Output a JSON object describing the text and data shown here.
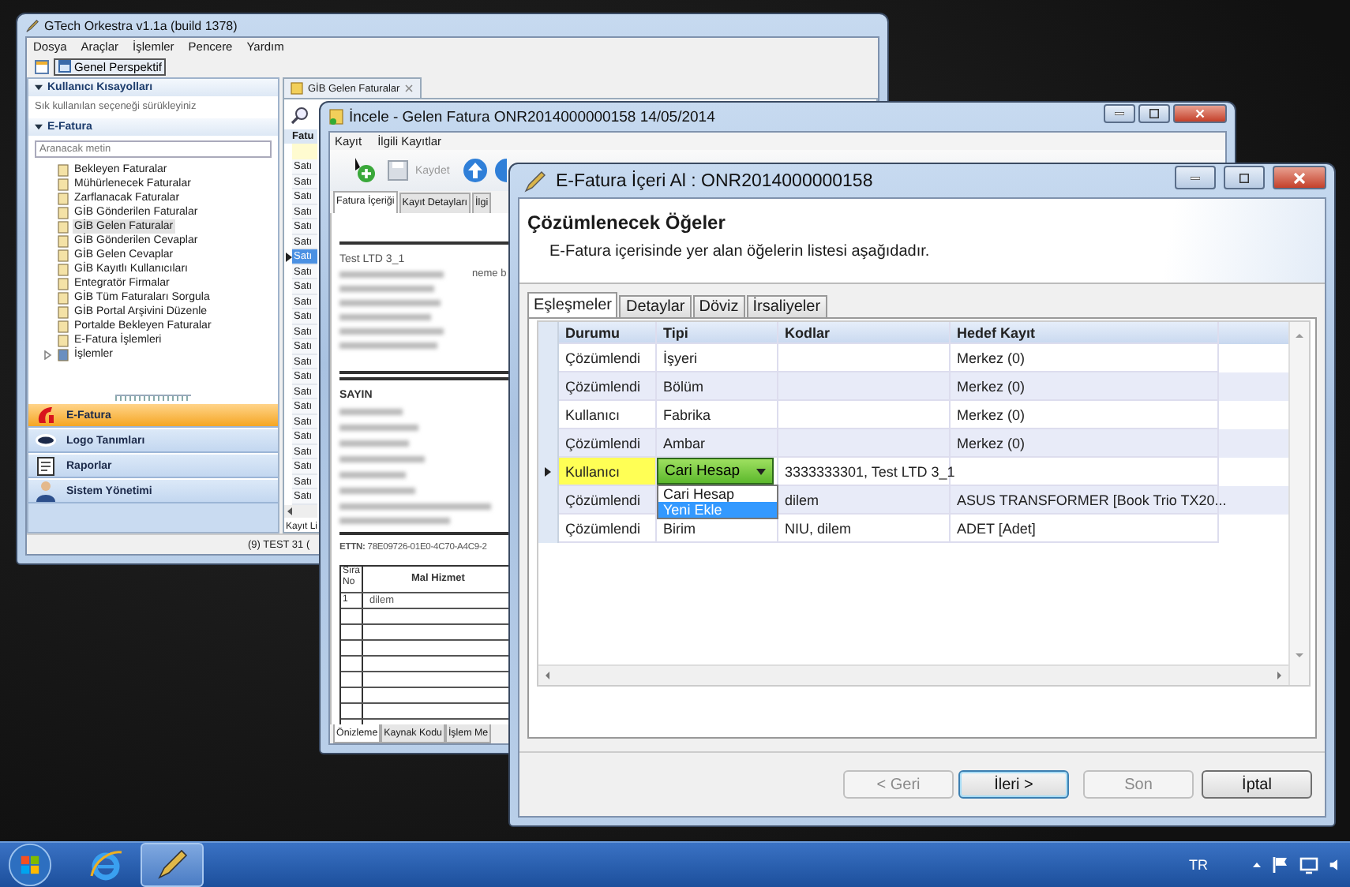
{
  "main_window": {
    "title": "GTech Orkestra v1.1a (build 1378)",
    "menu": [
      "Dosya",
      "Araçlar",
      "İşlemler",
      "Pencere",
      "Yardım"
    ],
    "perspective": "Genel Perspektif",
    "sidebar": {
      "shortcuts_header": "Kullanıcı Kısayolları",
      "shortcuts_hint": "Sık kullanılan seçeneği sürükleyiniz",
      "section_header": "E-Fatura",
      "search": {
        "placeholder": "Aranacak metin"
      },
      "items": [
        {
          "label": "Bekleyen Faturalar",
          "kind": "leaf",
          "selected": false
        },
        {
          "label": "Mühürlenecek Faturalar",
          "kind": "leaf",
          "selected": false
        },
        {
          "label": "Zarflanacak Faturalar",
          "kind": "leaf",
          "selected": false
        },
        {
          "label": "GİB Gönderilen Faturalar",
          "kind": "leaf",
          "selected": false
        },
        {
          "label": "GİB Gelen Faturalar",
          "kind": "leaf",
          "selected": true
        },
        {
          "label": "GİB Gönderilen Cevaplar",
          "kind": "leaf",
          "selected": false
        },
        {
          "label": "GİB Gelen Cevaplar",
          "kind": "leaf",
          "selected": false
        },
        {
          "label": "GİB Kayıtlı Kullanıcıları",
          "kind": "leaf",
          "selected": false
        },
        {
          "label": "Entegratör Firmalar",
          "kind": "leaf",
          "selected": false
        },
        {
          "label": "GİB Tüm Faturaları Sorgula",
          "kind": "leaf",
          "selected": false
        },
        {
          "label": "GİB Portal Arşivini Düzenle",
          "kind": "leaf",
          "selected": false
        },
        {
          "label": "Portalde Bekleyen Faturalar",
          "kind": "leaf",
          "selected": false
        },
        {
          "label": "E-Fatura İşlemleri",
          "kind": "leaf",
          "selected": false
        },
        {
          "label": "İşlemler",
          "kind": "group",
          "expanded": false,
          "selected": false
        }
      ]
    },
    "nav": [
      {
        "label": "E-Fatura",
        "kind": "efatura",
        "selected": true
      },
      {
        "label": "Logo Tanımları",
        "kind": "logo",
        "selected": false
      },
      {
        "label": "Raporlar",
        "kind": "reports",
        "selected": false
      },
      {
        "label": "Sistem Yönetimi",
        "kind": "admin",
        "selected": false
      }
    ],
    "tab": "GİB Gelen Faturalar",
    "list": {
      "column": "Fatu",
      "footer": "Kayıt Li",
      "rows": [
        {
          "text": "Satı",
          "selected": false
        },
        {
          "text": "Satı",
          "selected": false
        },
        {
          "text": "Satı",
          "selected": false
        },
        {
          "text": "Satı",
          "selected": false
        },
        {
          "text": "Satı",
          "selected": false
        },
        {
          "text": "Satı",
          "selected": false
        },
        {
          "text": "Satı",
          "selected": true
        },
        {
          "text": "Satı",
          "selected": false
        },
        {
          "text": "Satı",
          "selected": false
        },
        {
          "text": "Satı",
          "selected": false
        },
        {
          "text": "Satı",
          "selected": false
        },
        {
          "text": "Satı",
          "selected": false
        },
        {
          "text": "Satı",
          "selected": false
        },
        {
          "text": "Satı",
          "selected": false
        },
        {
          "text": "Satı",
          "selected": false
        },
        {
          "text": "Satı",
          "selected": false
        },
        {
          "text": "Satı",
          "selected": false
        },
        {
          "text": "Satı",
          "selected": false
        },
        {
          "text": "Satı",
          "selected": false
        },
        {
          "text": "Satı",
          "selected": false
        },
        {
          "text": "Satı",
          "selected": false
        },
        {
          "text": "Satı",
          "selected": false
        },
        {
          "text": "Satı",
          "selected": false
        }
      ]
    },
    "status_bar": "(9) TEST 31 ("
  },
  "invoice_window": {
    "title": "İncele - Gelen Fatura ONR2014000000158 14/05/2014",
    "menu": [
      "Kayıt",
      "İlgili Kayıtlar"
    ],
    "save_label": "Kaydet",
    "save_disabled": true,
    "tabs": [
      {
        "label": "Fatura İçeriği",
        "selected": true
      },
      {
        "label": "Kayıt Detayları",
        "selected": false
      },
      {
        "label": "İlgi",
        "selected": false
      }
    ],
    "document": {
      "company": "Test LTD 3_1",
      "fragment": "neme b",
      "recipient_heading": "SAYIN",
      "ettn": "**ETTN:** 78E09726-01E0-4C70-A4C9-2",
      "table": {
        "columns": [
          "Sıra No",
          "Mal Hizmet"
        ],
        "rows": [
          [
            "1",
            "dilem"
          ]
        ]
      }
    },
    "bottom_tabs": [
      {
        "label": "Önizleme",
        "selected": true
      },
      {
        "label": "Kaynak Kodu",
        "selected": false
      },
      {
        "label": "İşlem Me",
        "selected": false
      }
    ]
  },
  "dialog": {
    "title": "E-Fatura İçeri Al : ONR2014000000158",
    "heading": "Çözümlenecek Öğeler",
    "description": "E-Fatura içerisinde yer alan öğelerin listesi aşağıdadır.",
    "tabs": [
      {
        "label": "Eşleşmeler",
        "selected": true
      },
      {
        "label": "Detaylar",
        "selected": false
      },
      {
        "label": "Döviz",
        "selected": false
      },
      {
        "label": "İrsaliyeler",
        "selected": false
      }
    ],
    "table": {
      "columns": [
        "Durumu",
        "Tipi",
        "Kodlar",
        "Hedef Kayıt"
      ],
      "rows": [
        {
          "status": "Çözümlendi",
          "type": "İşyeri",
          "kind": "text",
          "target": "Merkez (0)",
          "selected": false
        },
        {
          "status": "Çözümlendi",
          "type": "Bölüm",
          "kind": "text",
          "target": "Merkez (0)",
          "selected": false
        },
        {
          "status": "Kullanıcı",
          "type": "Fabrika",
          "kind": "text",
          "target": "Merkez (0)",
          "selected": false
        },
        {
          "status": "Çözümlendi",
          "type": "Ambar",
          "kind": "text",
          "target": "Merkez (0)",
          "selected": false
        },
        {
          "status": "Kullanıcı",
          "type": "Cari Hesap",
          "kind": "combo",
          "codes": "3333333301, Test LTD 3_1",
          "selected": true
        },
        {
          "status": "Çözümlendi",
          "kind": "text",
          "codes": "dilem",
          "target": "ASUS TRANSFORMER [Book Trio TX20...",
          "selected": false
        },
        {
          "status": "Çözümlendi",
          "type": "Birim",
          "kind": "text",
          "codes": "NIU, dilem",
          "target": "ADET [Adet]",
          "selected": false
        }
      ]
    },
    "dropdown": [
      {
        "label": "Cari Hesap",
        "selected": false
      },
      {
        "label": "Yeni Ekle",
        "selected": true
      }
    ],
    "buttons": [
      {
        "label": "< Geri",
        "disabled": true,
        "default": false
      },
      {
        "label": "İleri >",
        "disabled": false,
        "default": true
      },
      {
        "label": "Son",
        "disabled": true,
        "default": false
      },
      {
        "label": "İptal",
        "disabled": false,
        "default": false
      }
    ]
  },
  "taskbar": {
    "language": "TR",
    "apps": [
      {
        "kind": "browser",
        "selected": false
      },
      {
        "kind": "app",
        "selected": true
      }
    ]
  }
}
